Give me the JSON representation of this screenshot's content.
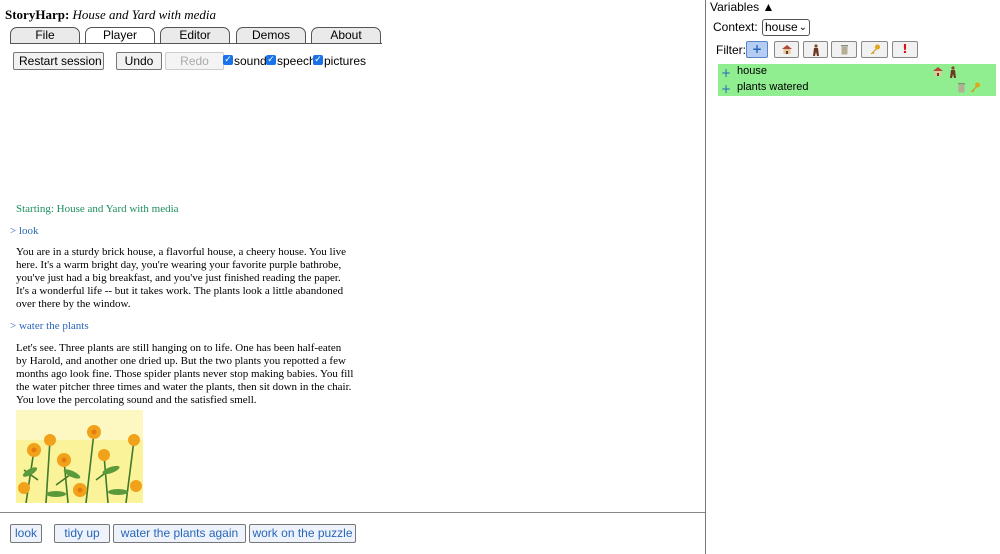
{
  "app": {
    "name": "StoryHarp:",
    "world_title": "House and Yard with media"
  },
  "tabs": [
    {
      "label": "File",
      "active": false
    },
    {
      "label": "Player",
      "active": true
    },
    {
      "label": "Editor",
      "active": false
    },
    {
      "label": "Demos",
      "active": false
    },
    {
      "label": "About",
      "active": false
    }
  ],
  "controls": {
    "restart_label": "Restart session",
    "undo_label": "Undo",
    "redo_label": "Redo",
    "redo_enabled": false,
    "sound_label": "sound",
    "sound_checked": true,
    "speech_label": "speech",
    "speech_checked": true,
    "pictures_label": "pictures",
    "pictures_checked": true
  },
  "transcript": {
    "start_message": "Starting: House and Yard with media",
    "cmd1": "> look",
    "para1": [
      "You are in a sturdy brick house, a flavorful house, a cheery house. You live",
      "here. It's a warm bright day, you're wearing your favorite purple bathrobe,",
      "you've just had a big breakfast, and you've just finished reading the paper.",
      "It's a wonderful life -- but it takes work. The plants look a little abandoned",
      "over there by the window."
    ],
    "cmd2": "> water the plants",
    "para2": [
      "Let's see. Three plants are still hanging on to life. One has been half-eaten",
      "by Harold, and another one dried up. But the two plants you repotted a few",
      "months ago look fine. Those spider plants never stop making babies. You fill",
      "the water pitcher three times and water the plants, then sit down in the chair.",
      "You love the percolating sound and the satisfied smell."
    ]
  },
  "choices": [
    "look",
    "tidy up",
    "water the plants again",
    "work on the puzzle"
  ],
  "variables": {
    "header": "Variables ▲",
    "context_label": "Context:",
    "context_value": "house",
    "filter_label": "Filter:",
    "filter_icons": [
      "plus-icon",
      "house-icon",
      "figure-icon",
      "trash-can-icon",
      "key-icon",
      "exclamation-icon"
    ],
    "items": [
      {
        "name": "house",
        "icons": [
          "house-icon",
          "figure-icon"
        ]
      },
      {
        "name": "plants watered",
        "icons": [
          "trash-can-icon",
          "key-icon"
        ]
      }
    ]
  },
  "colors": {
    "start_text": "#1e8f5f",
    "command_text": "#2966b8",
    "variable_row_bg": "#90ee90",
    "active_filter_bg": "#b5cdf2"
  }
}
